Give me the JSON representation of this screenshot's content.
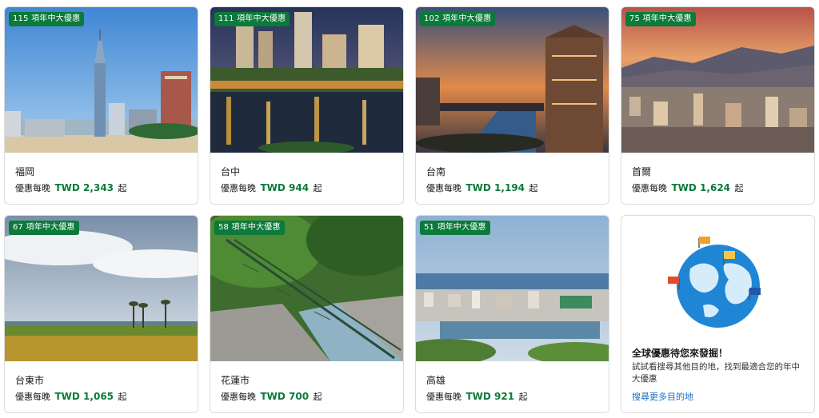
{
  "destinations": [
    {
      "badge": "115 項年中大優惠",
      "city": "福岡",
      "prefix": "優惠每晚",
      "price": "TWD 2,343",
      "suffix": "起"
    },
    {
      "badge": "111 項年中大優惠",
      "city": "台中",
      "prefix": "優惠每晚",
      "price": "TWD 944",
      "suffix": "起"
    },
    {
      "badge": "102 項年中大優惠",
      "city": "台南",
      "prefix": "優惠每晚",
      "price": "TWD 1,194",
      "suffix": "起"
    },
    {
      "badge": "75 項年中大優惠",
      "city": "首爾",
      "prefix": "優惠每晚",
      "price": "TWD 1,624",
      "suffix": "起"
    },
    {
      "badge": "67 項年中大優惠",
      "city": "台東市",
      "prefix": "優惠每晚",
      "price": "TWD 1,065",
      "suffix": "起"
    },
    {
      "badge": "58 項年中大優惠",
      "city": "花蓮市",
      "prefix": "優惠每晚",
      "price": "TWD 700",
      "suffix": "起"
    },
    {
      "badge": "51 項年中大優惠",
      "city": "高雄",
      "prefix": "優惠每晚",
      "price": "TWD 921",
      "suffix": "起"
    }
  ],
  "promo": {
    "title": "全球優惠待您來發掘！",
    "description": "試試看搜尋其他目的地，找到最適合您的年中大優惠",
    "link": "搜尋更多目的地",
    "icon": "globe-with-flags-icon"
  },
  "colors": {
    "badge": "#0b7a3a",
    "price": "#0b7a3a",
    "link": "#1a6fc4"
  }
}
